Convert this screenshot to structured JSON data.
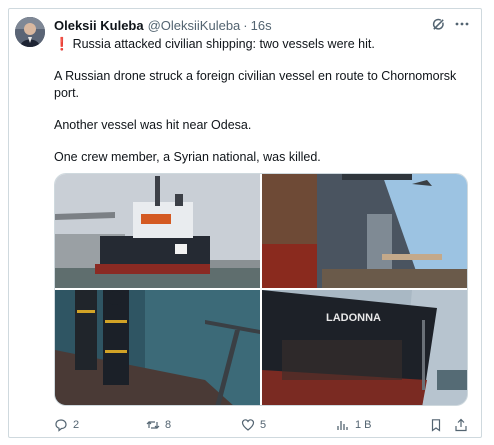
{
  "tweet": {
    "author_name": "Oleksii Kuleba",
    "author_handle": "@OleksiiKuleba",
    "separator": "·",
    "time": "16s",
    "text_line1_mark": "❗",
    "text_line1": "Russia attacked civilian shipping: two vessels were hit.",
    "text_para2": "A Russian drone struck a foreign civilian vessel en route to Chornomorsk port.",
    "text_para3": "Another vessel was hit near Odesa.",
    "text_para4": "One crew member, a Syrian national, was killed.",
    "ship_name_on_hull": "LADONNA"
  },
  "actions": {
    "replies": "2",
    "reposts": "8",
    "likes": "5",
    "views": "1 В"
  },
  "colors": {
    "text": "#0f1419",
    "muted": "#536471",
    "border": "#cfd9de",
    "alert_red": "#e0245e"
  },
  "icons": [
    "grok-icon",
    "more-icon",
    "reply-icon",
    "repost-icon",
    "like-icon",
    "views-icon",
    "bookmark-icon",
    "share-icon"
  ]
}
